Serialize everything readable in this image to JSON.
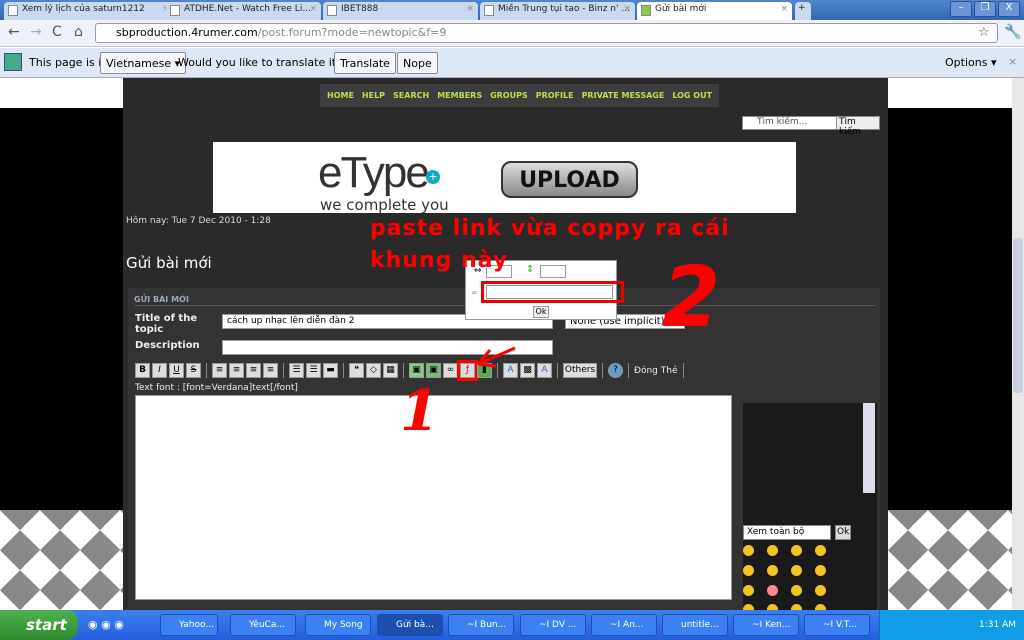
{
  "browser": {
    "tabs": [
      "Xem lý lịch của saturn1212",
      "ATDHE.Net - Watch Free Li...",
      "IBET888",
      "Miền Trung tụi tao - Binz n' ...",
      "Gửi bài mới"
    ],
    "url_host": "sbproduction.4rumer.com",
    "url_path": "/post.forum?mode=newtopic&f=9"
  },
  "translate": {
    "prefix": "This page is in",
    "language": "Vietnamese ▾",
    "question": "Would you like to translate it?",
    "translate": "Translate",
    "nope": "Nope",
    "options": "Options ▾"
  },
  "nav": [
    "HOME",
    "HELP",
    "SEARCH",
    "MEMBERS",
    "GROUPS",
    "PROFILE",
    "PRIVATE MESSAGE",
    "LOG OUT"
  ],
  "search": {
    "placeholder": "Tìm kiếm...",
    "button": "Tìm kiếm"
  },
  "banner": {
    "logo": "eType",
    "tagline": "we complete you",
    "upload": "UPLOAD"
  },
  "today": "Hôm nay: Tue 7 Dec 2010 - 1:28",
  "page_title": "Gửi bài mới",
  "form": {
    "section": "GỬI BÀI MỚI",
    "title_label": "Title of the topic",
    "title_value": "cách up nhạc lên diễn đàn 2",
    "desc_label": "Description",
    "icon_select": "None (use implicit)",
    "others": "Others",
    "close_tags": "Đóng Thẻ",
    "hint": "Text font : [font=Verdana]text[/font]"
  },
  "popup": {
    "ok": "Ok"
  },
  "annotation": {
    "line1": "paste link vừa coppy ra cái",
    "line2": "khung này",
    "num1": "1",
    "num2": "2"
  },
  "smilies": {
    "select": "Xem toàn bộ",
    "ok": "Ok"
  },
  "taskbar": {
    "start": "start",
    "tasks": [
      "Yahoo...",
      "YêuCa...",
      "My Song",
      "Gửi bà...",
      "~I Bun...",
      "~I DV ...",
      "~I An...",
      "untitle...",
      "~I Ken...",
      "~I V.T..."
    ],
    "clock": "1:31 AM"
  }
}
